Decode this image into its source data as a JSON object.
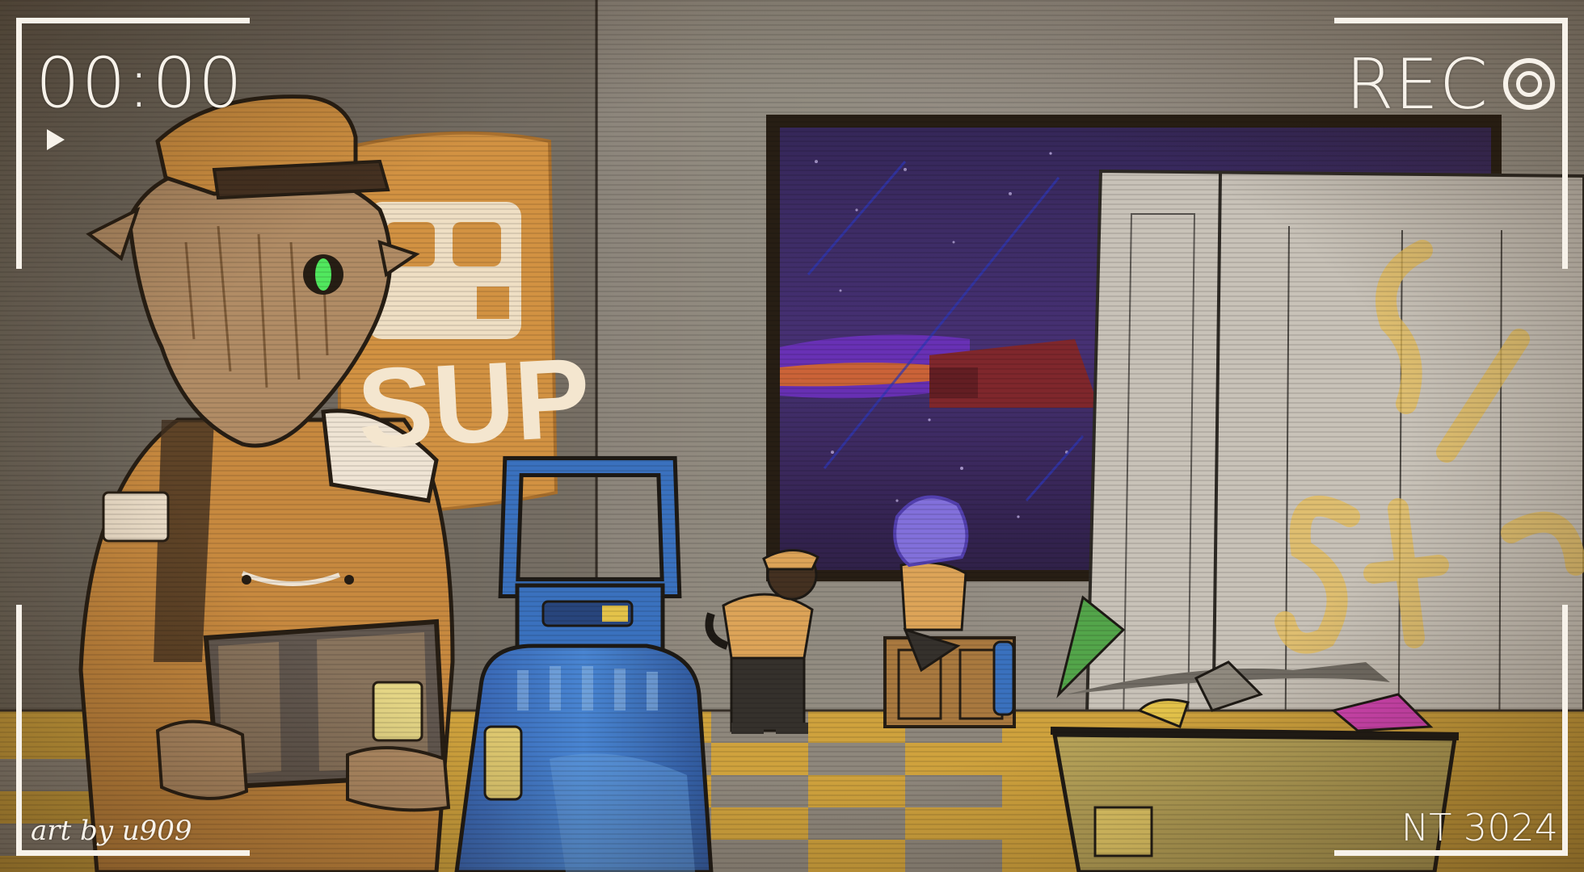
{
  "hud": {
    "timecode": "00:00",
    "rec_label": "REC",
    "credit": "art by u909",
    "watermark": "NT 3024"
  },
  "poster": {
    "text": "SUP"
  },
  "icons": {
    "play": "play-icon",
    "record": "record-icon"
  },
  "colors": {
    "hud": "#f7f2ea",
    "wall": "#8d8a84",
    "uniform": "#c8893e",
    "bottle": "#2f6fc8",
    "window_space": "#3a2a6a"
  }
}
